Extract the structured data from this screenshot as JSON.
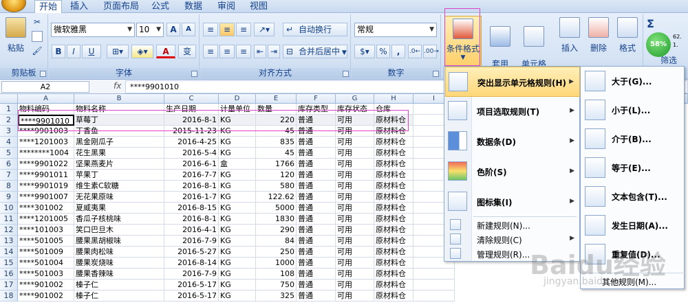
{
  "tabs": [
    "开始",
    "插入",
    "页面布局",
    "公式",
    "数据",
    "审阅",
    "视图"
  ],
  "ribbon": {
    "clipboard": {
      "label": "剪贴板",
      "paste": "粘贴"
    },
    "font": {
      "label": "字体",
      "name": "微软雅黑",
      "size": "10",
      "grow": "A",
      "shrink": "A",
      "bold": "B",
      "italic": "I",
      "underline": "U",
      "font_color": "A",
      "phonetic": "变"
    },
    "alignment": {
      "label": "对齐方式",
      "wrap": "自动换行",
      "merge": "合并后居中"
    },
    "number": {
      "label": "数字",
      "format": "常规",
      "percent": "%",
      "comma": ","
    },
    "styles": {
      "conditional": "条件格式",
      "table": "套用\n表格格式",
      "cell_style": "单元格\n样式"
    },
    "cells": {
      "insert": "插入",
      "delete": "删除",
      "format": "格式"
    },
    "editing": {
      "sigma": "Σ",
      "filter": "筛选",
      "badge": "58%",
      "mini1": "62.",
      "mini2": "1."
    }
  },
  "formula_bar": {
    "name_box": "A2",
    "fx": "fx",
    "content": "****9901010"
  },
  "columns": [
    "A",
    "B",
    "C",
    "D",
    "E",
    "F",
    "G",
    "H",
    "I"
  ],
  "rows": [
    {
      "n": "1",
      "a": "物料编码",
      "b": "物料名称",
      "c": "生产日期",
      "d": "计量单位",
      "e": "数量",
      "f": "库存类型",
      "g": "库存状态",
      "h": "仓库"
    },
    {
      "n": "2",
      "a": "****9901010",
      "b": "草莓丁",
      "c": "2016-8-1",
      "d": "KG",
      "e": "220",
      "f": "普通",
      "g": "可用",
      "h": "原材料仓"
    },
    {
      "n": "3",
      "a": "****9901003",
      "b": "丁香鱼",
      "c": "2015-11-23",
      "d": "KG",
      "e": "45",
      "f": "普通",
      "g": "可用",
      "h": "原材料仓"
    },
    {
      "n": "4",
      "a": "****1201003",
      "b": "黑金刚瓜子",
      "c": "2016-4-25",
      "d": "KG",
      "e": "835",
      "f": "普通",
      "g": "可用",
      "h": "原材料仓"
    },
    {
      "n": "5",
      "a": "********1004",
      "b": "花生黑果",
      "c": "2016-5-4",
      "d": "KG",
      "e": "45",
      "f": "普通",
      "g": "可用",
      "h": "原材料仓"
    },
    {
      "n": "6",
      "a": "****9901022",
      "b": "坚果燕麦片",
      "c": "2016-6-1",
      "d": "盒",
      "e": "1766",
      "f": "普通",
      "g": "可用",
      "h": "原材料仓"
    },
    {
      "n": "7",
      "a": "****9901011",
      "b": "苹果丁",
      "c": "2016-7-7",
      "d": "KG",
      "e": "120",
      "f": "普通",
      "g": "可用",
      "h": "原材料仓"
    },
    {
      "n": "8",
      "a": "****9901019",
      "b": "维生素C软糖",
      "c": "2016-8-1",
      "d": "KG",
      "e": "580",
      "f": "普通",
      "g": "可用",
      "h": "原材料仓"
    },
    {
      "n": "9",
      "a": "****9901007",
      "b": "无花果原味",
      "c": "2016-1-7",
      "d": "KG",
      "e": "122.62",
      "f": "普通",
      "g": "可用",
      "h": "原材料仓"
    },
    {
      "n": "10",
      "a": "****301002",
      "b": "夏威夷果",
      "c": "2016-8-15",
      "d": "KG",
      "e": "5000",
      "f": "普通",
      "g": "可用",
      "h": "原材料仓"
    },
    {
      "n": "11",
      "a": "****1201005",
      "b": "香瓜子核桃味",
      "c": "2016-8-1",
      "d": "KG",
      "e": "1830",
      "f": "普通",
      "g": "可用",
      "h": "原材料仓"
    },
    {
      "n": "12",
      "a": "****101003",
      "b": "笑口巴旦木",
      "c": "2016-4-1",
      "d": "KG",
      "e": "290",
      "f": "普通",
      "g": "可用",
      "h": "原材料仓"
    },
    {
      "n": "13",
      "a": "****501005",
      "b": "腰果黑胡椒味",
      "c": "2016-7-9",
      "d": "KG",
      "e": "84",
      "f": "普通",
      "g": "可用",
      "h": "原材料仓"
    },
    {
      "n": "14",
      "a": "****501009",
      "b": "腰果肉松味",
      "c": "2016-5-27",
      "d": "KG",
      "e": "250",
      "f": "普通",
      "g": "可用",
      "h": "原材料仓"
    },
    {
      "n": "15",
      "a": "****501004",
      "b": "腰果炭烧味",
      "c": "2016-8-14",
      "d": "KG",
      "e": "1000",
      "f": "普通",
      "g": "可用",
      "h": "原材料仓"
    },
    {
      "n": "16",
      "a": "****501003",
      "b": "腰果香辣味",
      "c": "2016-7-9",
      "d": "KG",
      "e": "108",
      "f": "普通",
      "g": "可用",
      "h": "原材料仓"
    },
    {
      "n": "17",
      "a": "****901002",
      "b": "榛子仁",
      "c": "2016-5-17",
      "d": "KG",
      "e": "750",
      "f": "普通",
      "g": "可用",
      "h": "原材料仓"
    },
    {
      "n": "18",
      "a": "****901002",
      "b": "榛子仁",
      "c": "2016-5-17",
      "d": "KG",
      "e": "325",
      "f": "普通",
      "g": "可用",
      "h": "原材料仓"
    }
  ],
  "menu": [
    {
      "label": "突出显示单元格规则(H)",
      "arrow": "▶"
    },
    {
      "label": "项目选取规则(T)",
      "arrow": "▶"
    },
    {
      "label": "数据条(D)",
      "arrow": "▶"
    },
    {
      "label": "色阶(S)",
      "arrow": "▶"
    },
    {
      "label": "图标集(I)",
      "arrow": "▶"
    }
  ],
  "menu_small": [
    {
      "label": "新建规则(N)..."
    },
    {
      "label": "清除规则(C)",
      "arrow": "▶"
    },
    {
      "label": "管理规则(R)..."
    }
  ],
  "submenu": [
    {
      "label": "大于(G)..."
    },
    {
      "label": "小于(L)..."
    },
    {
      "label": "介于(B)..."
    },
    {
      "label": "等于(E)..."
    },
    {
      "label": "文本包含(T)..."
    },
    {
      "label": "发生日期(A)..."
    },
    {
      "label": "重复值(D)..."
    },
    {
      "label": "其他规则(M)..."
    }
  ],
  "watermark": {
    "text": "Baidu经验",
    "url": "jingyan.baidu.com"
  }
}
